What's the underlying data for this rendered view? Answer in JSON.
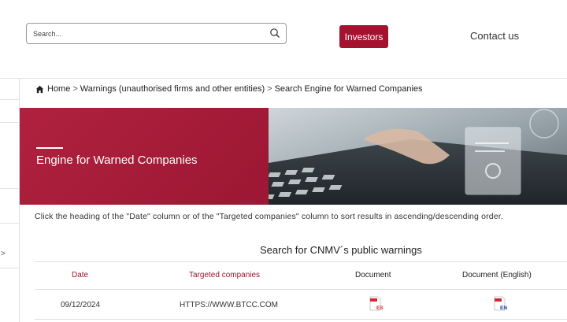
{
  "header": {
    "search_placeholder": "Search...",
    "investors_label": "Investors",
    "contact_label": "Contact us"
  },
  "breadcrumb": {
    "items": [
      "Home",
      "Warnings (unauthorised firms and other entities)",
      "Search Engine for Warned Companies"
    ],
    "separator": ">"
  },
  "banner": {
    "title": "Engine for Warned Companies"
  },
  "instructions": "Click the heading of the \"Date\" column or of the \"Targeted companies\" column to sort results in ascending/descending order.",
  "table": {
    "title": "Search for CNMV´s public warnings",
    "headers": [
      "Date",
      "Targeted companies",
      "Document",
      "Document (English)"
    ],
    "rows": [
      {
        "date": "09/12/2024",
        "company": "HTTPS://WWW.BTCC.COM",
        "doc_badge": "ES",
        "doc_en_badge": "EN"
      }
    ]
  },
  "sidebar": {
    "chevron": ">"
  },
  "colors": {
    "brand": "#a3122f",
    "text": "#333333"
  },
  "icons": [
    "search-icon",
    "home-icon",
    "pdf-es-icon",
    "pdf-en-icon",
    "chevron-right-icon"
  ]
}
